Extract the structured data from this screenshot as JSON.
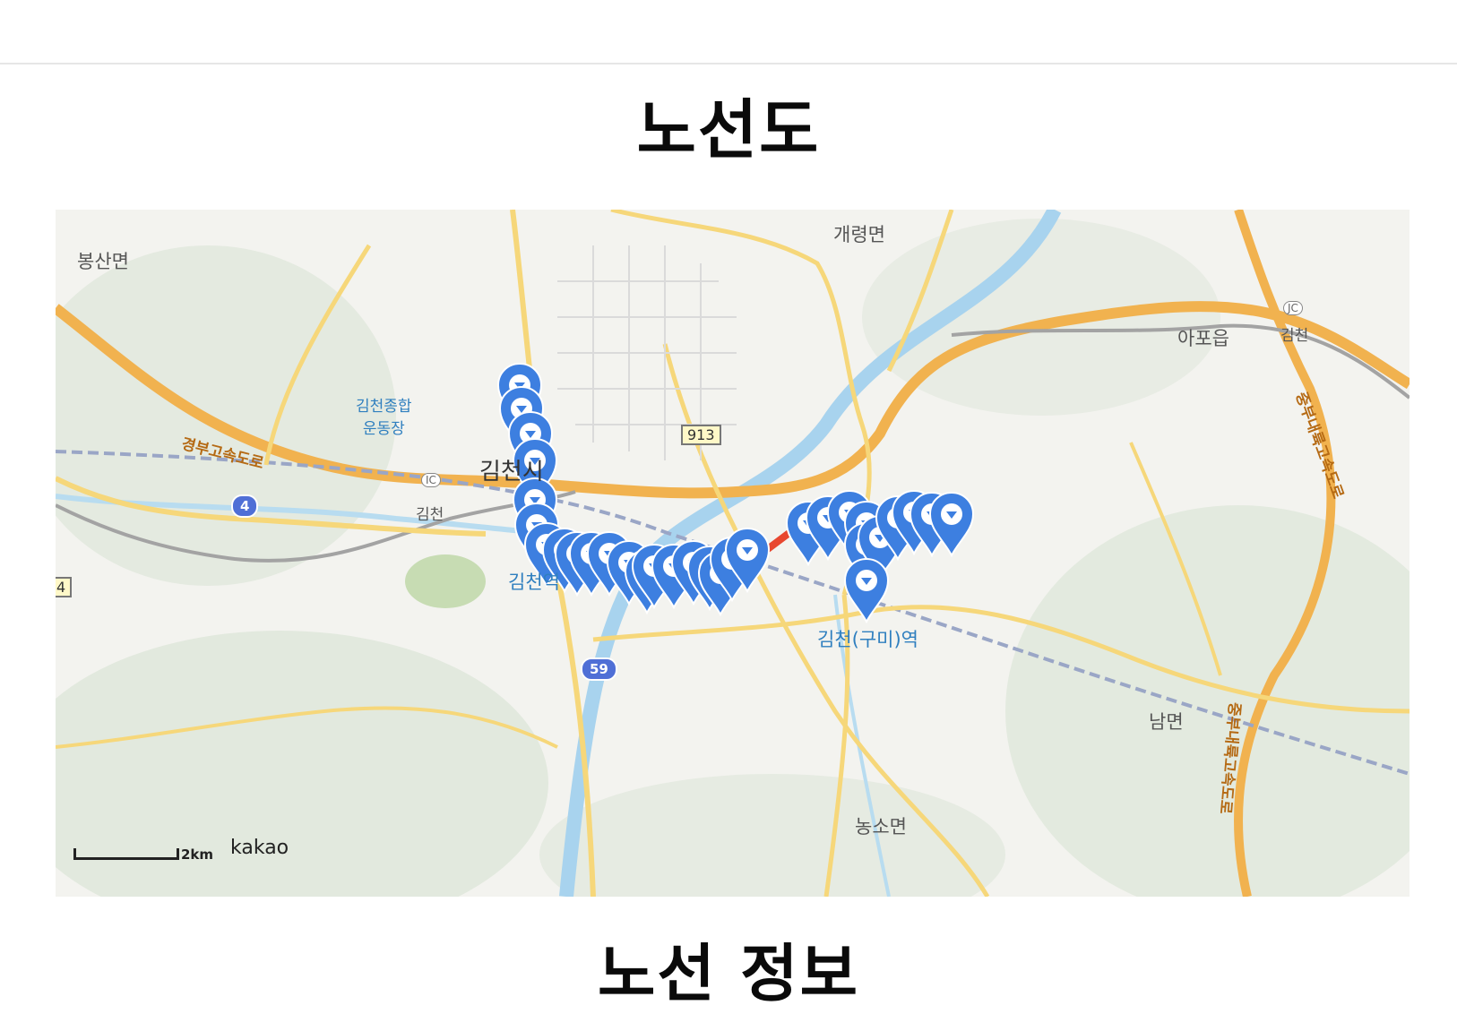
{
  "page": {
    "route_map_title": "노선도",
    "route_info_title": "노선 정보"
  },
  "map": {
    "places": {
      "bongsan": "봉산면",
      "gaeryeong": "개령면",
      "apo": "아포읍",
      "gimcheon_jc": "김천",
      "stadium": "김천종합\n운동장",
      "stadium_line1": "김천종합",
      "stadium_line2": "운동장",
      "city": "김천시",
      "gimcheon_ic": "김천",
      "gimcheon_station": "김천역",
      "gumi_station": "김천(구미)역",
      "nam": "남면",
      "nongso": "농소면"
    },
    "roads": {
      "gyeongbu": "경부고속도로",
      "jungbu": "중부내륙고속도로"
    },
    "shields": {
      "route4": "4",
      "route4_edge": "4",
      "route913": "913",
      "route59": "59",
      "ic": "IC",
      "jc": "JC"
    },
    "scale": "2km",
    "brand": "kakao",
    "route_color": "#e8472f",
    "marker_color": "#3d7fe0",
    "marker_icon": "map-pin-icon",
    "stop_count": 30
  }
}
